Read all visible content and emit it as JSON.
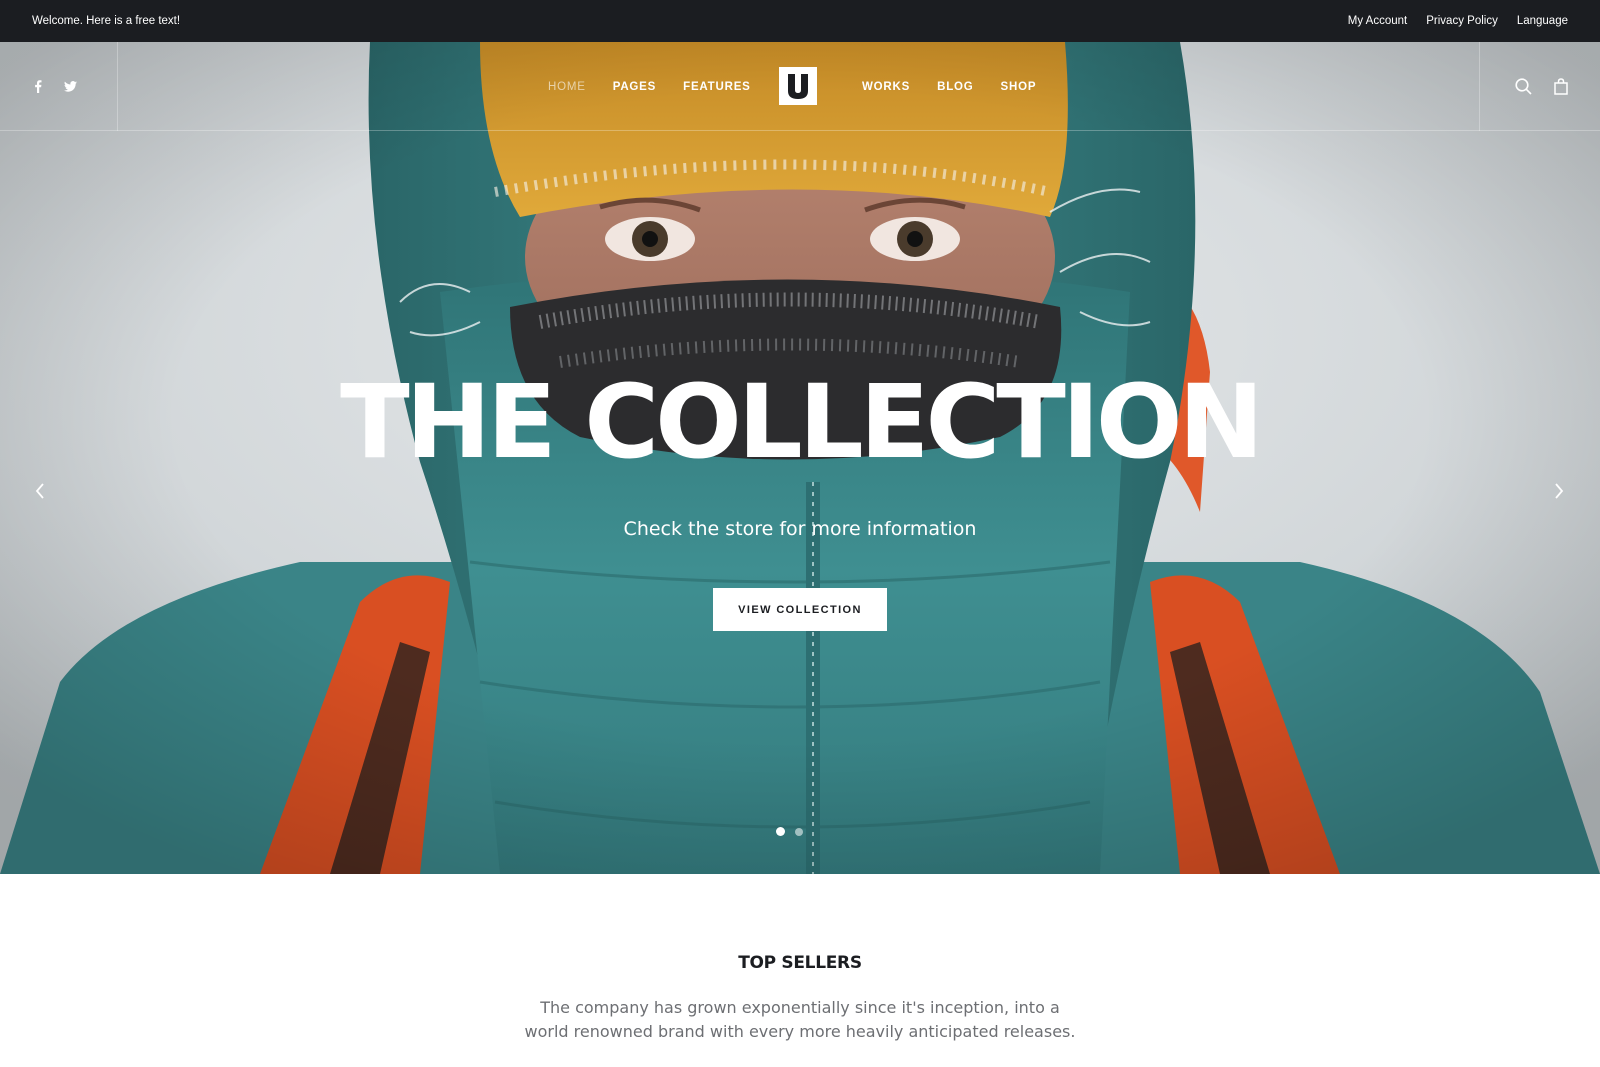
{
  "topbar": {
    "welcome": "Welcome. Here is a free text!",
    "links": [
      "My Account",
      "Privacy Policy",
      "Language"
    ]
  },
  "nav": {
    "left_items": [
      "HOME",
      "PAGES",
      "FEATURES"
    ],
    "right_items": [
      "WORKS",
      "BLOG",
      "SHOP"
    ],
    "active": "HOME",
    "logo_letter": "U",
    "social_icons": [
      "facebook-icon",
      "twitter-icon"
    ],
    "utility_icons": [
      "search-icon",
      "shopping-bag-icon"
    ]
  },
  "hero": {
    "title": "THE COLLECTION",
    "subtitle": "Check the store for more information",
    "button": "VIEW COLLECTION",
    "slides": 2,
    "active_slide": 1
  },
  "top_sellers": {
    "title": "TOP SELLERS",
    "text": "The company has grown exponentially since it's inception, into a world renowned brand with every more heavily anticipated releases."
  },
  "colors": {
    "topbar_bg": "#1b1d21",
    "jacket": "#3b8a8c",
    "beanie": "#d39a2e",
    "backpack": "#e0582a",
    "snow": "#d7dbde"
  }
}
